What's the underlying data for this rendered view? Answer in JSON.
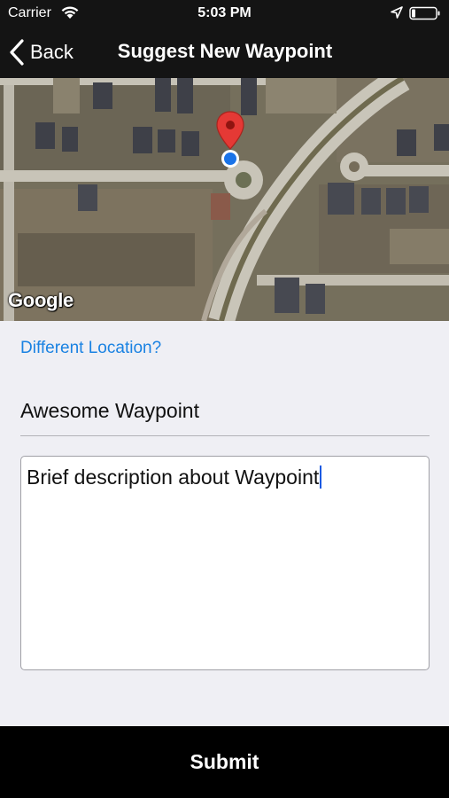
{
  "status_bar": {
    "carrier": "Carrier",
    "time": "5:03 PM",
    "icons": [
      "wifi-icon",
      "location-arrow-icon",
      "battery-icon"
    ]
  },
  "nav": {
    "back_label": "Back",
    "title": "Suggest New Waypoint"
  },
  "map": {
    "attribution": "Google",
    "pin_color": "#e53935",
    "location_dot_color": "#1a73e8"
  },
  "form": {
    "different_location_link": "Different Location?",
    "waypoint_name": "Awesome Waypoint",
    "description": "Brief description about Waypoint"
  },
  "submit": {
    "label": "Submit"
  },
  "colors": {
    "bar_background": "#141414",
    "link": "#1a82e2",
    "page_background": "#efeff4"
  }
}
